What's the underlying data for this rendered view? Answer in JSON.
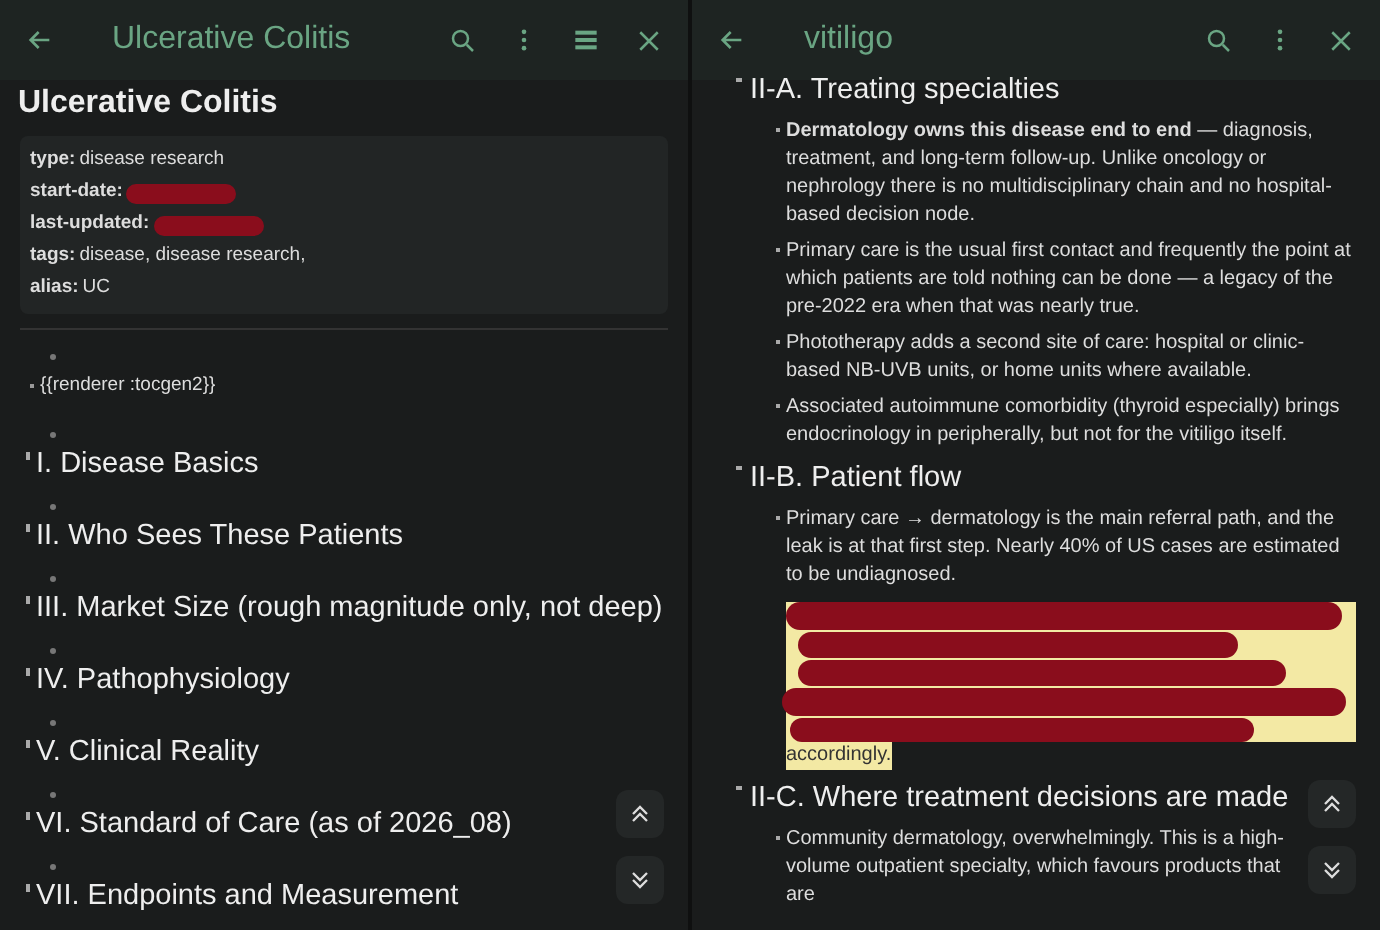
{
  "left_pane": {
    "title": "Ulcerative Colitis",
    "page_title": "Ulcerative Colitis",
    "properties": [
      {
        "kind": "text",
        "key": "type:",
        "value": "disease research"
      },
      {
        "kind": "redacted",
        "key": "start-date:"
      },
      {
        "kind": "redacted",
        "key": "last-updated:"
      },
      {
        "kind": "text",
        "key": "tags:",
        "value": "disease, disease research,"
      },
      {
        "kind": "text",
        "key": "alias:",
        "value": "UC"
      }
    ],
    "renderer": "{{renderer :tocgen2}}",
    "headings": [
      "I. Disease Basics",
      "II. Who Sees These Patients",
      "III. Market Size (rough magnitude only, not deep)",
      "IV. Pathophysiology",
      "V. Clinical Reality",
      "VI. Standard of Care (as of 2026_08)",
      "VII. Endpoints and Measurement"
    ]
  },
  "right_pane": {
    "title": "vitiligo",
    "sections": [
      {
        "heading": "II-A. Treating specialties",
        "bullets": [
          {
            "kind": "text",
            "text": "**Dermatology owns this disease end to end** — diagnosis, treatment, and long-term follow-up. Unlike oncology or nephrology there is no multidisciplinary chain and no hospital-based decision node."
          },
          {
            "kind": "text",
            "text": "Primary care is the usual first contact and frequently the point at which patients are told nothing can be done — a legacy of the pre-2022 era when that was nearly true."
          },
          {
            "kind": "text",
            "text": "Phototherapy adds a second site of care: hospital or clinic-based NB-UVB units, or home units where available."
          },
          {
            "kind": "text",
            "text": "Associated autoimmune comorbidity (thyroid especially) brings endocrinology in peripherally, but not for the vitiligo itself."
          }
        ]
      },
      {
        "heading": "II-B. Patient flow",
        "bullets": [
          {
            "kind": "text",
            "text": "Primary care → dermatology is the main referral path, and the leak is at that first step. Nearly 40% of US cases are estimated to be undiagnosed."
          },
          {
            "kind": "redacted_highlight",
            "text": "accordingly."
          }
        ]
      },
      {
        "heading": "II-C. Where treatment decisions are made",
        "bullets": [
          {
            "kind": "text",
            "text": "Community dermatology, overwhelmingly. This is a high-volume outpatient specialty, which favours products that are"
          }
        ]
      }
    ]
  }
}
